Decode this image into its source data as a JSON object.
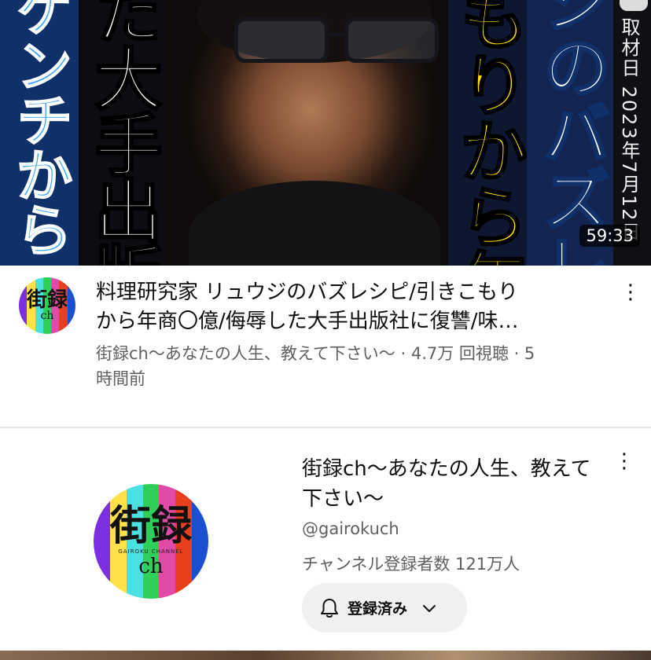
{
  "thumbnail": {
    "col1_text": "ケンチから「人殺し」",
    "col2_text": "た大手出版社Kに復讐",
    "col3_text": "もりから年商■億",
    "col4_text": "ジのバズレシピ",
    "col5_text": "取材日 2023年7月12日",
    "duration": "59:33"
  },
  "video": {
    "title_line1": "料理研究家 リュウジのバズレシピ/引きこもり",
    "title_line2": "から年商〇億/侮辱した大手出版社に復讐/味…",
    "meta_line1": "街録ch〜あなたの人生、教えて下さい〜 · 4.7万 回視聴 · 5",
    "meta_line2": "時間前",
    "menu_glyph": "⋮"
  },
  "avatar": {
    "kanji": "街録",
    "ch": "ch",
    "sub": "GAIROKU CHANNEL",
    "stripe_colors": [
      "#7b2fe0",
      "#ffe14a",
      "#4de0e0",
      "#2ecf5a",
      "#e04aa8",
      "#e8401c",
      "#1a4fd0"
    ]
  },
  "channel": {
    "name": "街録ch〜あなたの人生、教えて下さい〜",
    "handle": "@gairokuch",
    "subscribers": "チャンネル登録者数 121万人",
    "subscribe_label": "登録済み",
    "bell_icon": "bell-icon",
    "chevron_icon": "chevron-down-icon",
    "menu_glyph": "⋮"
  }
}
